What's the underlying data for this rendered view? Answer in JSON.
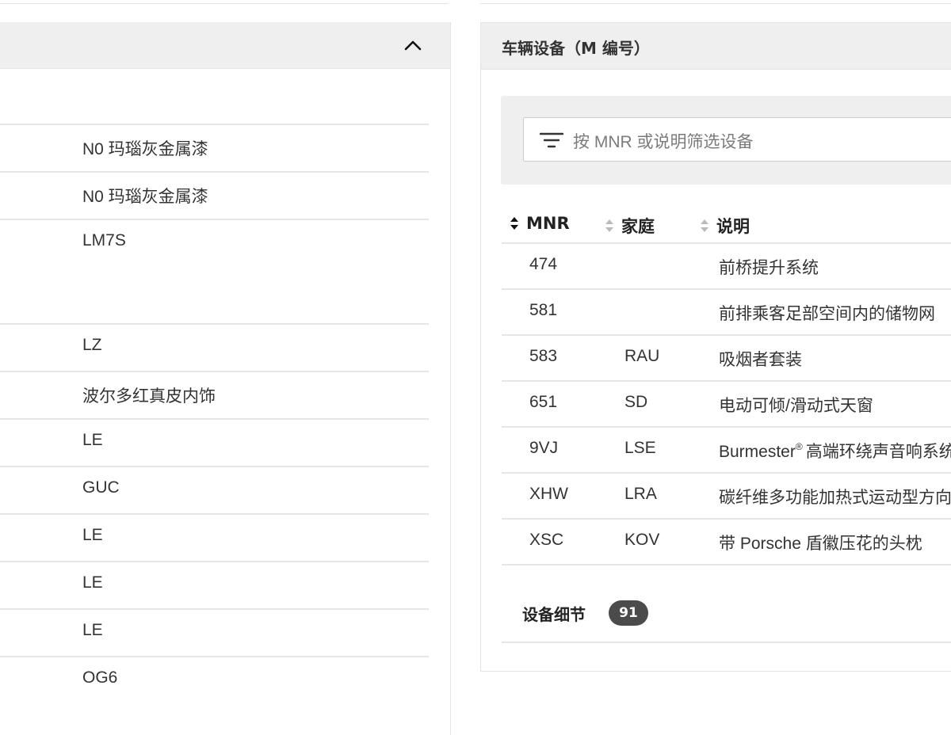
{
  "left_panel": {
    "rows": [
      {
        "value": "N0 玛瑙灰金属漆",
        "height": 58
      },
      {
        "value": "N0 玛瑙灰金属漆",
        "height": 58
      },
      {
        "value": "LM7S",
        "height": 130
      },
      {
        "value": "LZ",
        "height": 58
      },
      {
        "value": "波尔多红真皮内饰",
        "height": 58
      },
      {
        "value": "LE",
        "height": 58
      },
      {
        "value": "GUC",
        "height": 58
      },
      {
        "value": "LE",
        "height": 58
      },
      {
        "value": "LE",
        "height": 58
      },
      {
        "value": "LE",
        "height": 58
      },
      {
        "value": "OG6",
        "height": 58
      }
    ]
  },
  "right_panel": {
    "title": "车辆设备（M 编号）",
    "filter": {
      "placeholder": "按 MNR 或说明筛选设备"
    },
    "columns": {
      "mnr": "MNR",
      "family": "家庭",
      "description": "说明"
    },
    "rows": [
      {
        "mnr": "474",
        "family": "",
        "description": "前桥提升系统"
      },
      {
        "mnr": "581",
        "family": "",
        "description": "前排乘客足部空间内的储物网"
      },
      {
        "mnr": "583",
        "family": "RAU",
        "description": "吸烟者套装"
      },
      {
        "mnr": "651",
        "family": "SD",
        "description": "电动可倾/滑动式天窗"
      },
      {
        "mnr": "9VJ",
        "family": "LSE",
        "description_pre": "Burmester",
        "description_sup": "®",
        "description_post": "高端环绕声音响系统"
      },
      {
        "mnr": "XHW",
        "family": "LRA",
        "description": "碳纤维多功能加热式运动型方向盘"
      },
      {
        "mnr": "XSC",
        "family": "KOV",
        "description": "带 Porsche 盾徽压花的头枕"
      }
    ],
    "details": {
      "label": "设备细节",
      "count": "91"
    }
  },
  "icons": {
    "collapse": "chevron-up-icon",
    "filter": "filter-lines-icon",
    "sort_active": "sort-active-icon",
    "sort": "sort-icon"
  },
  "colors": {
    "header_bg": "#efefef",
    "badge_bg": "#4b4b4b",
    "border": "#e3e3e3"
  }
}
